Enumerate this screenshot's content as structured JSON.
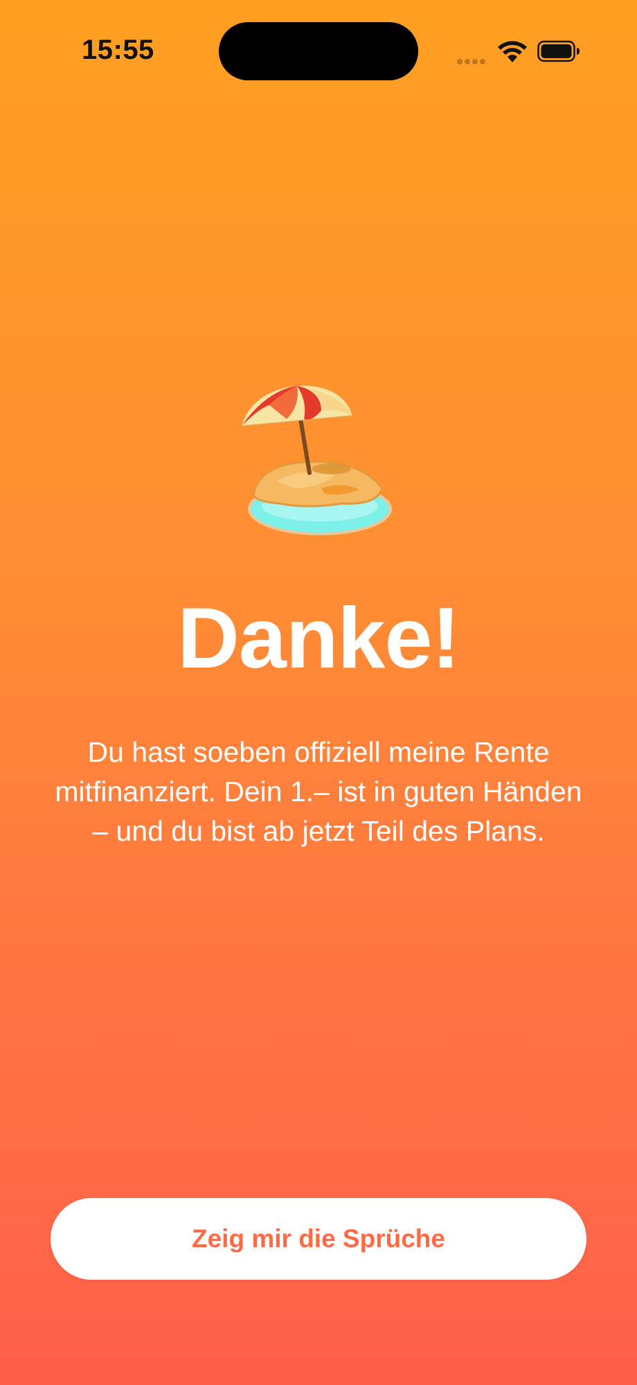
{
  "status_bar": {
    "time": "15:55",
    "icons": [
      "cellular-signal-icon",
      "wifi-icon",
      "battery-icon"
    ]
  },
  "hero": {
    "illustration": "beach-umbrella-island-icon",
    "title": "Danke!",
    "message": "Du hast soeben offiziell meine Rente mitfinanziert. Dein 1.– ist in guten Händen – und du bist ab jetzt Teil des Plans."
  },
  "cta": {
    "label": "Zeig mir die Sprüche"
  },
  "colors": {
    "gradient_top": "#FFA021",
    "gradient_bottom": "#FF5F4B",
    "button_text": "#FF6A45",
    "button_bg": "#FFFFFF",
    "text": "#FFFFFF"
  }
}
